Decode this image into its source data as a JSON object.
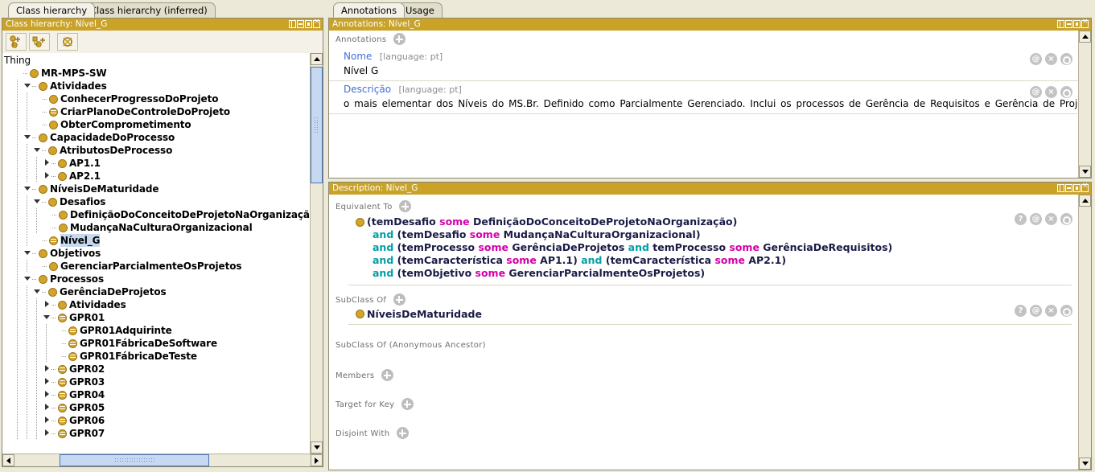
{
  "left": {
    "tabs": [
      {
        "label": "Class hierarchy",
        "active": true
      },
      {
        "label": "Class hierarchy (inferred)",
        "active": false
      }
    ],
    "panel_title": "Class hierarchy: Nível_G",
    "toolbar": [
      {
        "name": "add-subclass-button",
        "tooltip": "Add subclass"
      },
      {
        "name": "add-sibling-class-button",
        "tooltip": "Add sibling class"
      },
      {
        "name": "delete-class-button",
        "tooltip": "Delete class"
      }
    ],
    "tree": [
      {
        "label": "Thing",
        "depth": 0,
        "twisty": "none",
        "icon": "none",
        "bold": false,
        "selected": false
      },
      {
        "label": "MR-MPS-SW",
        "depth": 1,
        "twisty": "none",
        "icon": "class",
        "bold": true,
        "selected": false
      },
      {
        "label": "Atividades",
        "depth": 2,
        "twisty": "down",
        "icon": "class",
        "bold": true,
        "selected": false
      },
      {
        "label": "ConhecerProgressoDoProjeto",
        "depth": 3,
        "twisty": "none",
        "icon": "class",
        "bold": true,
        "selected": false
      },
      {
        "label": "CriarPlanoDeControleDoProjeto",
        "depth": 3,
        "twisty": "none",
        "icon": "defined",
        "bold": true,
        "selected": false
      },
      {
        "label": "ObterComprometimento",
        "depth": 3,
        "twisty": "none",
        "icon": "class",
        "bold": true,
        "selected": false
      },
      {
        "label": "CapacidadeDoProcesso",
        "depth": 2,
        "twisty": "down",
        "icon": "class",
        "bold": true,
        "selected": false
      },
      {
        "label": "AtributosDeProcesso",
        "depth": 3,
        "twisty": "down",
        "icon": "class",
        "bold": true,
        "selected": false
      },
      {
        "label": "AP1.1",
        "depth": 4,
        "twisty": "right",
        "icon": "class",
        "bold": true,
        "selected": false
      },
      {
        "label": "AP2.1",
        "depth": 4,
        "twisty": "right",
        "icon": "class",
        "bold": true,
        "selected": false
      },
      {
        "label": "NíveisDeMaturidade",
        "depth": 2,
        "twisty": "down",
        "icon": "class",
        "bold": true,
        "selected": false
      },
      {
        "label": "Desafios",
        "depth": 3,
        "twisty": "down",
        "icon": "class",
        "bold": true,
        "selected": false
      },
      {
        "label": "DefiniçãoDoConceitoDeProjetoNaOrganização",
        "depth": 4,
        "twisty": "none",
        "icon": "class",
        "bold": true,
        "selected": false
      },
      {
        "label": "MudançaNaCulturaOrganizacional",
        "depth": 4,
        "twisty": "none",
        "icon": "class",
        "bold": true,
        "selected": false
      },
      {
        "label": "Nível_G",
        "depth": 3,
        "twisty": "none",
        "icon": "defined",
        "bold": true,
        "selected": true
      },
      {
        "label": "Objetivos",
        "depth": 2,
        "twisty": "down",
        "icon": "class",
        "bold": true,
        "selected": false
      },
      {
        "label": "GerenciarParcialmenteOsProjetos",
        "depth": 3,
        "twisty": "none",
        "icon": "class",
        "bold": true,
        "selected": false
      },
      {
        "label": "Processos",
        "depth": 2,
        "twisty": "down",
        "icon": "class",
        "bold": true,
        "selected": false
      },
      {
        "label": "GerênciaDeProjetos",
        "depth": 3,
        "twisty": "down",
        "icon": "class",
        "bold": true,
        "selected": false
      },
      {
        "label": "Atividades",
        "depth": 4,
        "twisty": "right",
        "icon": "class",
        "bold": true,
        "selected": false
      },
      {
        "label": "GPR01",
        "depth": 4,
        "twisty": "down",
        "icon": "defined",
        "bold": true,
        "selected": false
      },
      {
        "label": "GPR01Adquirinte",
        "depth": 5,
        "twisty": "none",
        "icon": "defined",
        "bold": true,
        "selected": false
      },
      {
        "label": "GPR01FábricaDeSoftware",
        "depth": 5,
        "twisty": "none",
        "icon": "defined",
        "bold": true,
        "selected": false
      },
      {
        "label": "GPR01FábricaDeTeste",
        "depth": 5,
        "twisty": "none",
        "icon": "defined",
        "bold": true,
        "selected": false
      },
      {
        "label": "GPR02",
        "depth": 4,
        "twisty": "right",
        "icon": "defined",
        "bold": true,
        "selected": false
      },
      {
        "label": "GPR03",
        "depth": 4,
        "twisty": "right",
        "icon": "defined",
        "bold": true,
        "selected": false
      },
      {
        "label": "GPR04",
        "depth": 4,
        "twisty": "right",
        "icon": "defined",
        "bold": true,
        "selected": false
      },
      {
        "label": "GPR05",
        "depth": 4,
        "twisty": "right",
        "icon": "defined",
        "bold": true,
        "selected": false
      },
      {
        "label": "GPR06",
        "depth": 4,
        "twisty": "right",
        "icon": "defined",
        "bold": true,
        "selected": false
      },
      {
        "label": "GPR07",
        "depth": 4,
        "twisty": "right",
        "icon": "defined",
        "bold": true,
        "selected": false
      }
    ]
  },
  "right": {
    "tabs": [
      {
        "label": "Annotations",
        "active": true
      },
      {
        "label": "Usage",
        "active": false
      }
    ],
    "annotations_panel": {
      "title": "Annotations: Nível_G",
      "section_label": "Annotations",
      "rows": [
        {
          "property": "Nome",
          "language": "[language: pt]",
          "value": "Nível G",
          "buttons": [
            "@",
            "×",
            "o"
          ]
        },
        {
          "property": "Descrição",
          "language": "[language: pt]",
          "value": "o mais elementar dos Níveis do MS.Br. Definido como Parcialmente Gerenciado. Inclui os processos de Gerência de Requisitos e Gerência de Projetos;",
          "buttons": [
            "@",
            "×",
            "o"
          ]
        }
      ]
    },
    "description_panel": {
      "title": "Description: Nível_G",
      "equivalent_to": {
        "label": "Equivalent To",
        "buttons": [
          "?",
          "@",
          "×",
          "o"
        ],
        "lines": [
          [
            {
              "t": "(temDesafio ",
              "k": "t"
            },
            {
              "t": "some",
              "k": "some"
            },
            {
              "t": " DefiniçãoDoConceitoDeProjetoNaOrganização)",
              "k": "t"
            }
          ],
          [
            {
              "t": "and",
              "k": "and"
            },
            {
              "t": " (temDesafio ",
              "k": "t"
            },
            {
              "t": "some",
              "k": "some"
            },
            {
              "t": " MudançaNaCulturaOrganizacional)",
              "k": "t"
            }
          ],
          [
            {
              "t": "and",
              "k": "and"
            },
            {
              "t": " (temProcesso ",
              "k": "t"
            },
            {
              "t": "some",
              "k": "some"
            },
            {
              "t": " GerênciaDeProjetos ",
              "k": "t"
            },
            {
              "t": "and",
              "k": "and"
            },
            {
              "t": " temProcesso ",
              "k": "t"
            },
            {
              "t": "some",
              "k": "some"
            },
            {
              "t": " GerênciaDeRequisitos)",
              "k": "t"
            }
          ],
          [
            {
              "t": "and",
              "k": "and"
            },
            {
              "t": " (temCaracterística ",
              "k": "t"
            },
            {
              "t": "some",
              "k": "some"
            },
            {
              "t": " AP1.1) ",
              "k": "t"
            },
            {
              "t": "and",
              "k": "and"
            },
            {
              "t": " (temCaracterística ",
              "k": "t"
            },
            {
              "t": "some",
              "k": "some"
            },
            {
              "t": " AP2.1)",
              "k": "t"
            }
          ],
          [
            {
              "t": "and",
              "k": "and"
            },
            {
              "t": " (temObjetivo ",
              "k": "t"
            },
            {
              "t": "some",
              "k": "some"
            },
            {
              "t": " GerenciarParcialmenteOsProjetos)",
              "k": "t"
            }
          ]
        ]
      },
      "subclass_of": {
        "label": "SubClass Of",
        "items": [
          {
            "label": "NíveisDeMaturidade",
            "buttons": [
              "?",
              "@",
              "×",
              "o"
            ]
          }
        ]
      },
      "subclass_of_anonymous": {
        "label": "SubClass Of (Anonymous Ancestor)",
        "items": []
      },
      "members": {
        "label": "Members",
        "items": []
      },
      "target_for_key": {
        "label": "Target for Key",
        "items": []
      },
      "disjoint_with": {
        "label": "Disjoint With",
        "items": []
      }
    }
  },
  "colors": {
    "titlebar": "#c9a227",
    "class_icon": "#d3a428",
    "property_link": "#3f6fd6",
    "keyword_and": "#00a0a8",
    "keyword_some": "#d400aa",
    "entity_text": "#1a1a46",
    "selection": "#c7d9ef"
  }
}
